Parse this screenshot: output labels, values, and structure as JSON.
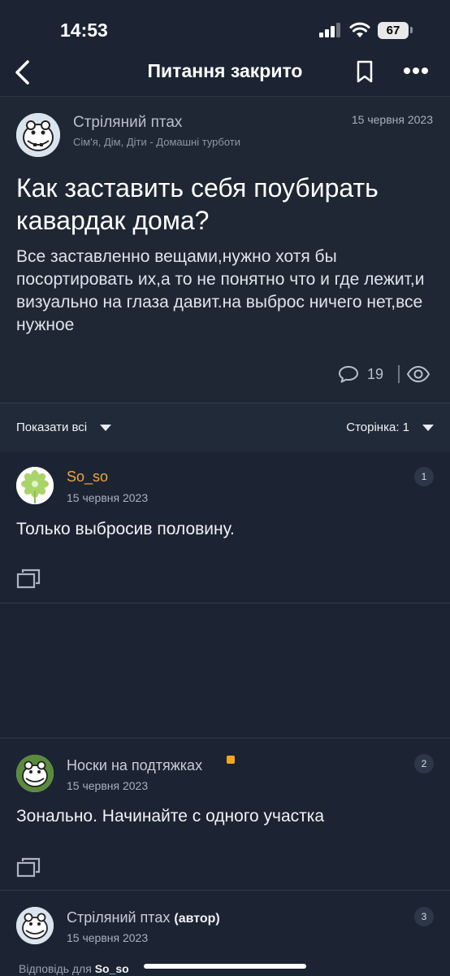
{
  "status_bar": {
    "time": "14:53",
    "battery": "67"
  },
  "nav": {
    "title": "Питання закрито"
  },
  "post": {
    "author": "Стріляний птах",
    "category": "Сім'я, Дім, Діти - Домашні турботи",
    "date": "15 червня 2023",
    "title": "Как заставить себя поубирать кавардак дома?",
    "body": "Все заставленно вещами,нужно хотя бы посортировать их,а то не понятно что и где лежит,и визуально на глаза давит.на выброс ничего нет,все нужное",
    "comments_count": "19"
  },
  "filter": {
    "show_all": "Показати всі",
    "page": "Сторінка: 1"
  },
  "replies": [
    {
      "author": "So_so",
      "date": "15 червня 2023",
      "text": "Только выбросив половину.",
      "number": "1",
      "name_color": "#f0a53a"
    },
    {
      "author": "Носки на подтяжках",
      "date": "15 червня 2023",
      "text": "Зонально. Начинайте с одного участка",
      "number": "2",
      "name_color": "#c7ccd6"
    },
    {
      "author": "Стріляний птах",
      "author_tag": "(автор)",
      "date": "15 червня 2023",
      "number": "3",
      "name_color": "#c7ccd6"
    }
  ],
  "reply_to": {
    "prefix": "Відповідь для",
    "name": "So_so"
  },
  "icons": [
    "back-icon",
    "bookmark-icon",
    "more-icon",
    "comment-icon",
    "eye-icon",
    "quote-icon",
    "hippo-avatar-icon",
    "flower-avatar-icon"
  ]
}
